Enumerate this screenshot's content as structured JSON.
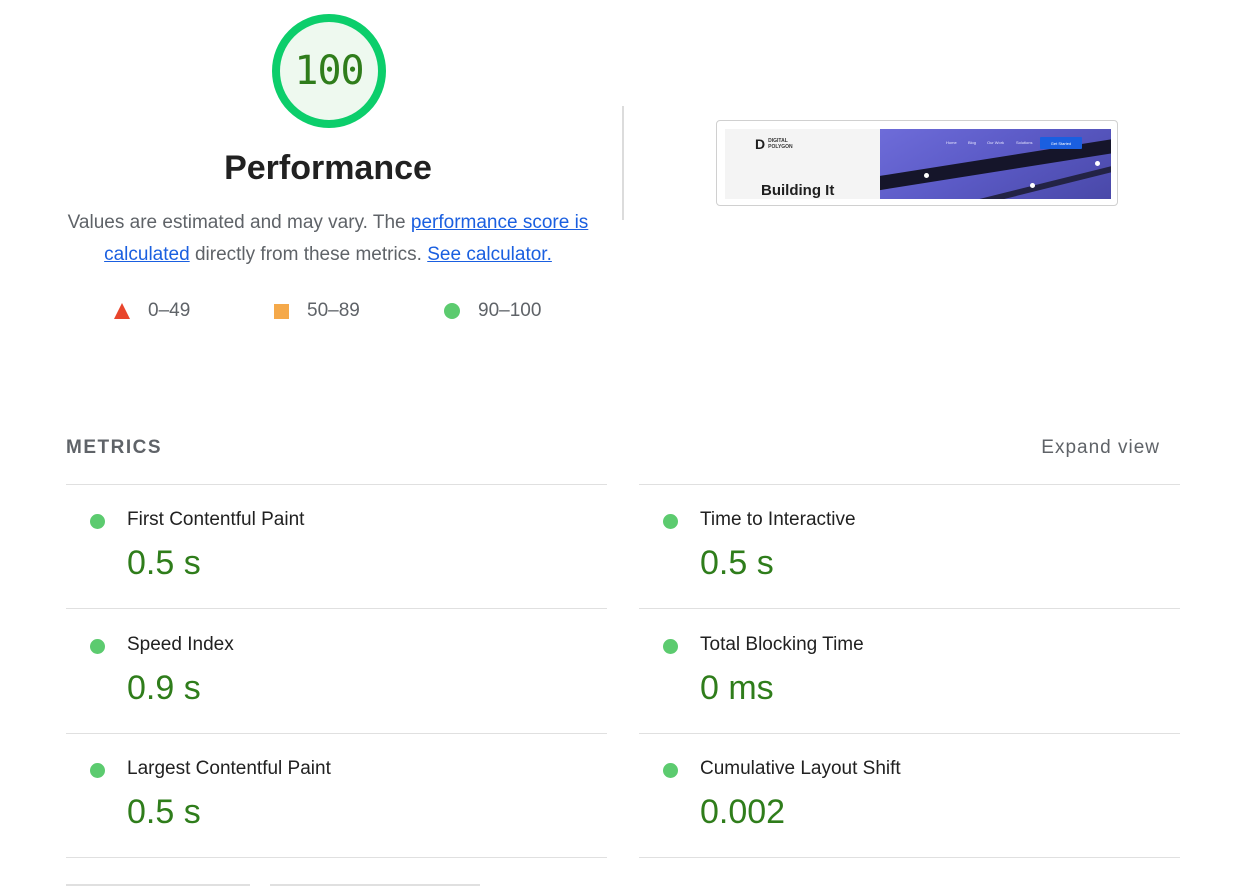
{
  "score": {
    "value": "100",
    "fraction": 1.0,
    "color": "#2f7d1b",
    "ring_color": "#0cce6b",
    "fill_color": "#eef9ef"
  },
  "category": {
    "title": "Performance",
    "description_prefix": "Values are estimated and may vary. The ",
    "score_link": "performance score is calculated",
    "description_middle": " directly from these metrics. ",
    "calculator_link": "See calculator."
  },
  "legend": [
    {
      "range": "0–49",
      "shape": "triangle",
      "color": "#e8452c"
    },
    {
      "range": "50–89",
      "shape": "square",
      "color": "#f5a94a"
    },
    {
      "range": "90–100",
      "shape": "circle",
      "color": "#5ccb6f"
    }
  ],
  "screenshot": {
    "brand_mark": "D",
    "brand_words_1": "DIGITAL",
    "brand_words_2": "POLYGON",
    "headline": "Building It",
    "nav": [
      "Home",
      "Blog",
      "Our Work",
      "Solutions"
    ],
    "cta": "Get Started"
  },
  "metrics": {
    "header": "METRICS",
    "expand_label": "Expand view",
    "items": [
      {
        "title": "First Contentful Paint",
        "value": "0.5 s",
        "status_color": "#5ccb6f"
      },
      {
        "title": "Time to Interactive",
        "value": "0.5 s",
        "status_color": "#5ccb6f"
      },
      {
        "title": "Speed Index",
        "value": "0.9 s",
        "status_color": "#5ccb6f"
      },
      {
        "title": "Total Blocking Time",
        "value": "0 ms",
        "status_color": "#5ccb6f"
      },
      {
        "title": "Largest Contentful Paint",
        "value": "0.5 s",
        "status_color": "#5ccb6f"
      },
      {
        "title": "Cumulative Layout Shift",
        "value": "0.002",
        "status_color": "#5ccb6f"
      }
    ]
  }
}
